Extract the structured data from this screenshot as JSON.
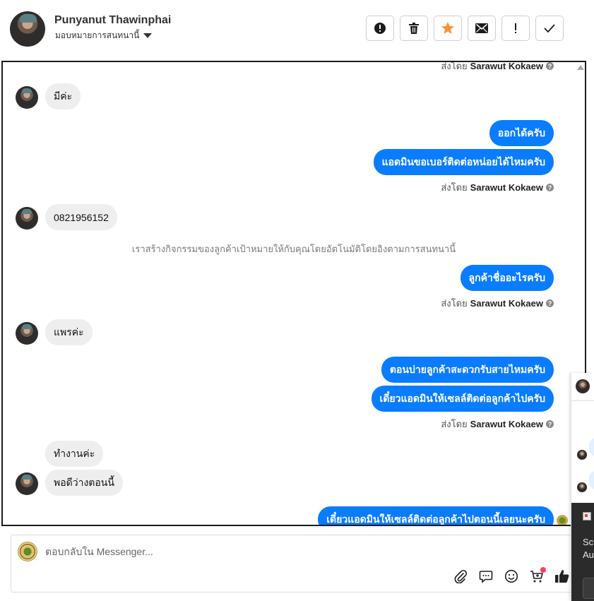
{
  "header": {
    "contact_name": "Punyanut Thawinphai",
    "assign_label": "มอบหมายการสนทนานี้",
    "actions": [
      {
        "name": "spam-button",
        "icon": "alert-circle-icon",
        "glyph": "!"
      },
      {
        "name": "delete-button",
        "icon": "trash-icon",
        "glyph": "🗑"
      },
      {
        "name": "follow-up-button",
        "icon": "star-icon",
        "glyph": "★",
        "color": "#f7923a"
      },
      {
        "name": "mark-unread-button",
        "icon": "envelope-icon",
        "glyph": "✉"
      },
      {
        "name": "priority-button",
        "icon": "exclamation-icon",
        "glyph": "!"
      },
      {
        "name": "mark-done-button",
        "icon": "checkmark-icon",
        "glyph": "✓"
      }
    ]
  },
  "chat": {
    "sent_by_prefix": "ส่งโดย",
    "sender_name": "Sarawut Kokaew",
    "system_note": "เราสร้างกิจกรรมของลูกค้าเป้าหมายให้กับคุณโดยอัตโนมัติโดยอิงตามการสนทนานี้",
    "messages": [
      {
        "dir": "in",
        "text": "มีค่ะ"
      },
      {
        "dir": "out",
        "text": "ออกได้ครับ"
      },
      {
        "dir": "out",
        "text": "แอดมินขอเบอร์ติดต่อหน่อยได้ไหมครับ"
      },
      {
        "dir": "in",
        "text": "0821956152"
      },
      {
        "dir": "out",
        "text": "ลูกค้าชื่ออะไรครับ"
      },
      {
        "dir": "in",
        "text": "แพรค่ะ"
      },
      {
        "dir": "out",
        "text": "ตอนบ่ายลูกค้าสะดวกรับสายไหมครับ"
      },
      {
        "dir": "out",
        "text": "เดี๋ยวแอดมินให้เซลล์ติดต่อลูกค้าไปครับ"
      },
      {
        "dir": "in",
        "text": "ทำงานค่ะ"
      },
      {
        "dir": "in",
        "text": "พอดีว่างตอนนี้"
      },
      {
        "dir": "out",
        "text": "เดี๋ยวแอดมินให้เซลล์ติดต่อลูกค้าไปตอนนี้เลยนะครับ"
      }
    ]
  },
  "composer": {
    "placeholder": "ตอบกลับใน Messenger...",
    "tools": [
      {
        "name": "attach-button",
        "icon": "paperclip-icon"
      },
      {
        "name": "saved-reply-button",
        "icon": "chat-bubble-icon"
      },
      {
        "name": "emoji-button",
        "icon": "smiley-icon"
      },
      {
        "name": "shop-button",
        "icon": "cart-icon"
      },
      {
        "name": "like-button",
        "icon": "thumbs-up-icon"
      }
    ]
  },
  "side_panel": {
    "text_line1": "Scr",
    "text_line2": "Au"
  },
  "colors": {
    "outgoing": "#0a7cff",
    "incoming": "#eeeeee",
    "star": "#f7923a",
    "notification_dot": "#ff3b5c"
  }
}
